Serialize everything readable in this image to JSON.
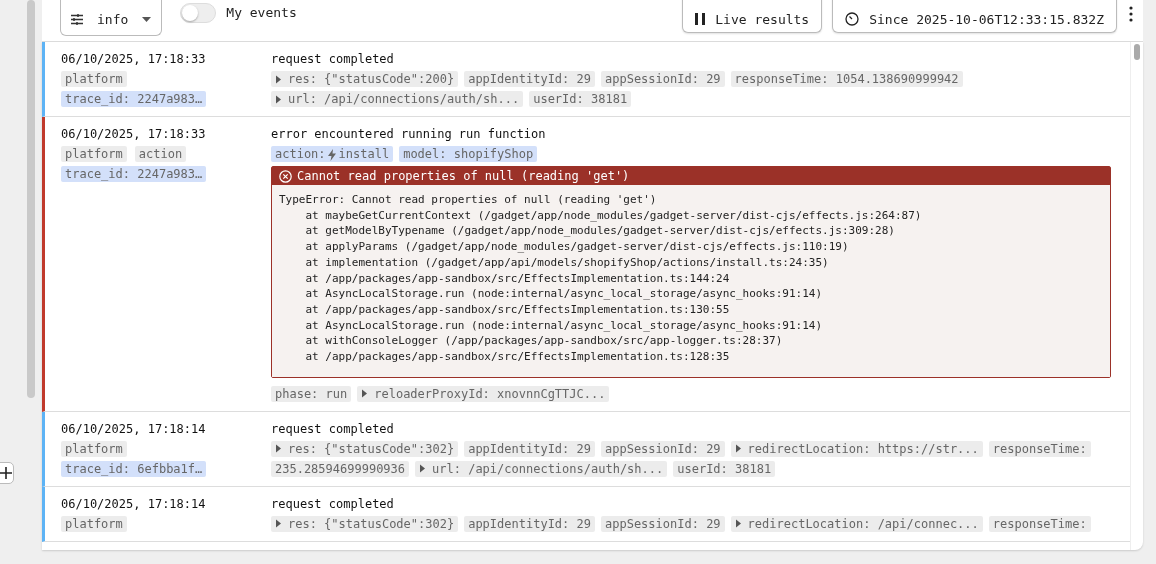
{
  "toolbar": {
    "level_filter": "info",
    "my_events": {
      "label": "My events",
      "on": false
    },
    "live_button": "Live results",
    "since_button": "Since 2025-10-06T12:33:15.832Z"
  },
  "entries": [
    {
      "kind": "info",
      "time": "06/10/2025, 17:18:33",
      "message": "request completed",
      "labels": [
        {
          "text": "platform",
          "highlight": false
        },
        {
          "text": "trace_id: 2247a983…",
          "highlight": true
        }
      ],
      "tags": [
        {
          "kind": "expandable",
          "text": "res: {\"statusCode\":200}"
        },
        {
          "kind": "plain",
          "text": "appIdentityId: 29"
        },
        {
          "kind": "plain",
          "text": "appSessionId: 29"
        },
        {
          "kind": "plain",
          "text": "responseTime: 1054.138690999942"
        },
        {
          "kind": "expandable",
          "text": "url: /api/connections/auth/sh..."
        },
        {
          "kind": "plain",
          "text": "userId: 38181"
        }
      ]
    },
    {
      "kind": "error",
      "time": "06/10/2025, 17:18:33",
      "message": "error encountered running run function",
      "labels": [
        {
          "text": "platform",
          "highlight": false
        },
        {
          "text": "action",
          "highlight": false
        },
        {
          "text": "trace_id: 2247a983…",
          "highlight": true
        }
      ],
      "tags": [
        {
          "kind": "action",
          "text": "action:",
          "value": "install"
        },
        {
          "kind": "highlight",
          "text": "model: shopifyShop"
        }
      ],
      "error": {
        "title": "Cannot read properties of null (reading 'get')",
        "lines": [
          "TypeError: Cannot read properties of null (reading 'get')",
          "    at maybeGetCurrentContext (/gadget/app/node_modules/gadget-server/dist-cjs/effects.js:264:87)",
          "    at getModelByTypename (/gadget/app/node_modules/gadget-server/dist-cjs/effects.js:309:28)",
          "    at applyParams (/gadget/app/node_modules/gadget-server/dist-cjs/effects.js:110:19)",
          "    at implementation (/gadget/app/api/models/shopifyShop/actions/install.ts:24:35)",
          "    at /app/packages/app-sandbox/src/EffectsImplementation.ts:144:24",
          "    at AsyncLocalStorage.run (node:internal/async_local_storage/async_hooks:91:14)",
          "    at /app/packages/app-sandbox/src/EffectsImplementation.ts:130:55",
          "    at AsyncLocalStorage.run (node:internal/async_local_storage/async_hooks:91:14)",
          "    at withConsoleLogger (/app/packages/app-sandbox/src/app-logger.ts:28:37)",
          "    at /app/packages/app-sandbox/src/EffectsImplementation.ts:128:35"
        ]
      },
      "footer_tags": [
        {
          "kind": "plain",
          "text": "phase: run"
        },
        {
          "kind": "expandable",
          "text": "reloaderProxyId: xnovnnCgTTJC..."
        }
      ]
    },
    {
      "kind": "info",
      "time": "06/10/2025, 17:18:14",
      "message": "request completed",
      "labels": [
        {
          "text": "platform",
          "highlight": false
        },
        {
          "text": "trace_id: 6efbba1f…",
          "highlight": true
        }
      ],
      "tags": [
        {
          "kind": "expandable",
          "text": "res: {\"statusCode\":302}"
        },
        {
          "kind": "plain",
          "text": "appIdentityId: 29"
        },
        {
          "kind": "plain",
          "text": "appSessionId: 29"
        },
        {
          "kind": "expandable",
          "text": "redirectLocation: https://str..."
        },
        {
          "kind": "plain",
          "text": "responseTime:"
        },
        {
          "kind": "plain",
          "text": "235.28594699990936"
        },
        {
          "kind": "expandable",
          "text": "url: /api/connections/auth/sh..."
        },
        {
          "kind": "plain",
          "text": "userId: 38181"
        }
      ]
    },
    {
      "kind": "info",
      "time": "06/10/2025, 17:18:14",
      "message": "request completed",
      "labels": [
        {
          "text": "platform",
          "highlight": false
        }
      ],
      "tags": [
        {
          "kind": "expandable",
          "text": "res: {\"statusCode\":302}"
        },
        {
          "kind": "plain",
          "text": "appIdentityId: 29"
        },
        {
          "kind": "plain",
          "text": "appSessionId: 29"
        },
        {
          "kind": "expandable",
          "text": "redirectLocation: /api/connec..."
        },
        {
          "kind": "plain",
          "text": "responseTime:"
        }
      ]
    }
  ]
}
